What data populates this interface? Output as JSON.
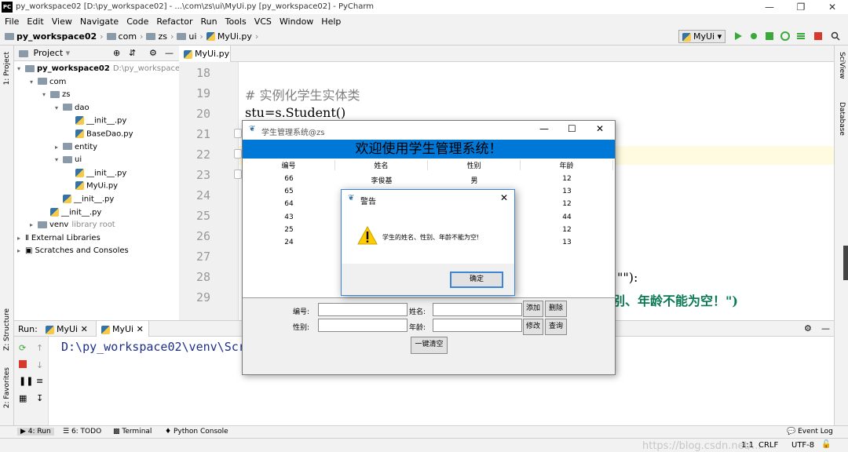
{
  "window": {
    "title": "py_workspace02 [D:\\py_workspace02] - ...\\com\\zs\\ui\\MyUi.py [py_workspace02] - PyCharm",
    "logo": "PC"
  },
  "menu": [
    "File",
    "Edit",
    "View",
    "Navigate",
    "Code",
    "Refactor",
    "Run",
    "Tools",
    "VCS",
    "Window",
    "Help"
  ],
  "breadcrumb": [
    "py_workspace02",
    "com",
    "zs",
    "ui",
    "MyUi.py"
  ],
  "run_config": "MyUi",
  "left_stripe": {
    "project": "1: Project",
    "structure": "Z: Structure",
    "favorites": "2: Favorites"
  },
  "right_stripe": {
    "sciview": "SciView",
    "database": "Database"
  },
  "project_panel": {
    "title": "Project",
    "tree": [
      {
        "label": "py_workspace02",
        "extra": "D:\\py_workspace02",
        "depth": 0,
        "type": "folder",
        "open": true
      },
      {
        "label": "com",
        "depth": 1,
        "type": "folder",
        "open": true
      },
      {
        "label": "zs",
        "depth": 2,
        "type": "folder",
        "open": true
      },
      {
        "label": "dao",
        "depth": 3,
        "type": "folder",
        "open": true
      },
      {
        "label": "__init__.py",
        "depth": 4,
        "type": "py"
      },
      {
        "label": "BaseDao.py",
        "depth": 4,
        "type": "py"
      },
      {
        "label": "entity",
        "depth": 3,
        "type": "folder",
        "open": false
      },
      {
        "label": "ui",
        "depth": 3,
        "type": "folder",
        "open": true
      },
      {
        "label": "__init__.py",
        "depth": 4,
        "type": "py"
      },
      {
        "label": "MyUi.py",
        "depth": 4,
        "type": "py"
      },
      {
        "label": "__init__.py",
        "depth": 3,
        "type": "py"
      },
      {
        "label": "__init__.py",
        "depth": 2,
        "type": "py"
      },
      {
        "label": "venv",
        "extra": "library root",
        "depth": 1,
        "type": "folder",
        "open": false
      },
      {
        "label": "External Libraries",
        "depth": 0,
        "type": "lib",
        "open": false
      },
      {
        "label": "Scratches and Consoles",
        "depth": 0,
        "type": "scratch",
        "open": false
      }
    ]
  },
  "editor": {
    "tab": "MyUi.py",
    "lines": [
      {
        "n": "18",
        "code": ""
      },
      {
        "n": "19",
        "code": "# 实例化学生实体类"
      },
      {
        "n": "20",
        "code": "stu=s.Student()"
      },
      {
        "n": "21",
        "code": ""
      },
      {
        "n": "22",
        "code": ""
      },
      {
        "n": "23",
        "code": ""
      },
      {
        "n": "24",
        "code": ""
      },
      {
        "n": "25",
        "code": ""
      },
      {
        "n": "26",
        "code": ""
      },
      {
        "n": "27",
        "code": ""
      },
      {
        "n": "28",
        "code": ""
      },
      {
        "n": "29",
        "code": ""
      }
    ],
    "fragment_28": "\"\"):",
    "fragment_29": "别、年龄不能为空！\")"
  },
  "run_panel": {
    "label": "Run:",
    "tabs": [
      "MyUi",
      "MyUi"
    ],
    "output": "D:\\py_workspace02\\venv\\Scr"
  },
  "bottom_tabs": [
    "4: Run",
    "6: TODO",
    "Terminal",
    "Python Console"
  ],
  "event_log": "Event Log",
  "status": {
    "position": "1:1",
    "line_sep": "CRLF",
    "encoding": "UTF-8"
  },
  "watermark": "https://blog.csdn.net/...",
  "tk_window": {
    "title": "学生管理系统@zs",
    "banner": "欢迎使用学生管理系统！",
    "columns": [
      "编号",
      "姓名",
      "性别",
      "年龄"
    ],
    "rows": [
      [
        "66",
        "李俊基",
        "男",
        "12"
      ],
      [
        "65",
        "",
        "",
        "13"
      ],
      [
        "64",
        "",
        "",
        "12"
      ],
      [
        "43",
        "",
        "",
        "44"
      ],
      [
        "25",
        "",
        "",
        "12"
      ],
      [
        "24",
        "",
        "",
        "13"
      ]
    ],
    "labels": {
      "id": "编号:",
      "name": "姓名:",
      "sex": "性别:",
      "age": "年龄:"
    },
    "buttons": {
      "add": "添加",
      "delete": "删除",
      "edit": "修改",
      "query": "查询",
      "clear": "一键清空"
    }
  },
  "dialog": {
    "title": "警告",
    "message": "学生的姓名、性别、年龄不能为空!",
    "ok": "确定"
  }
}
